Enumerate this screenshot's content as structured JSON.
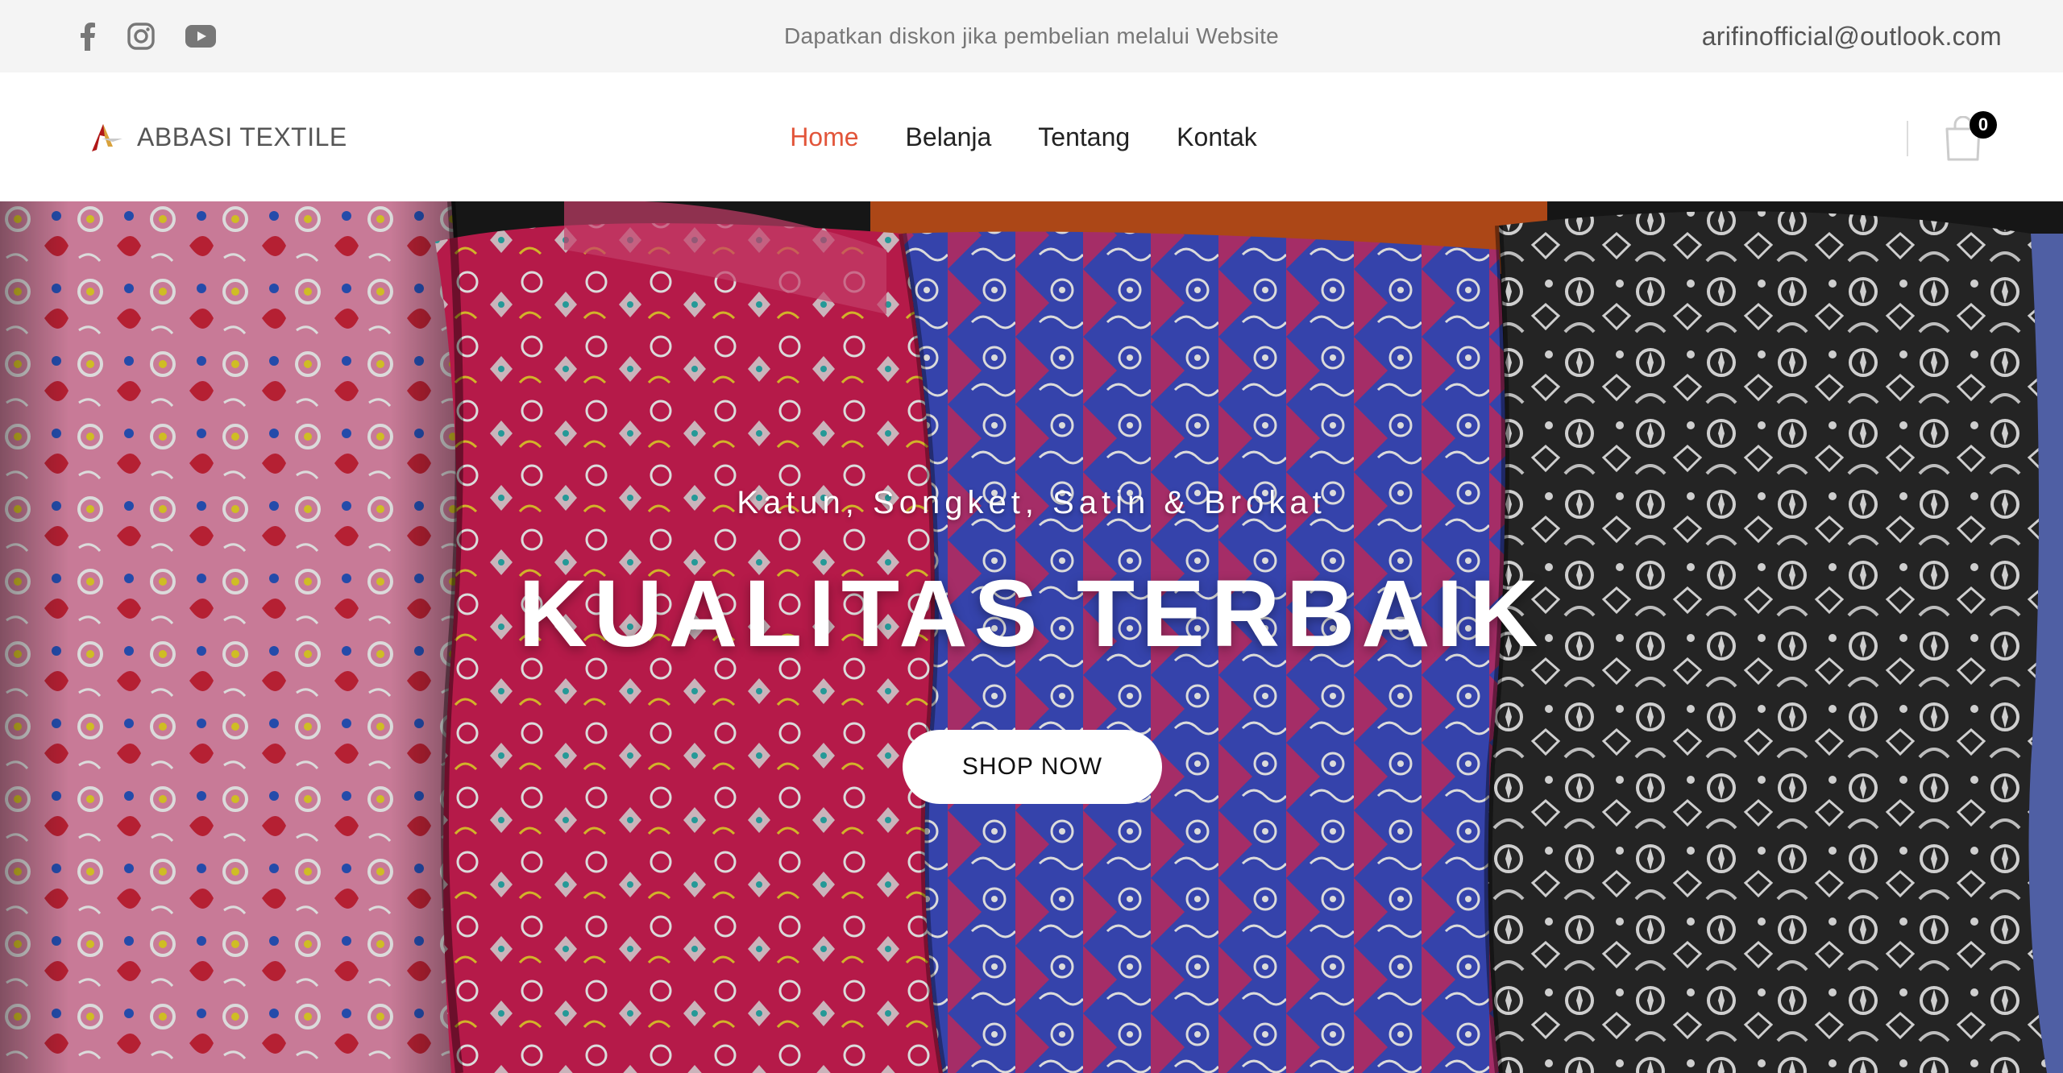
{
  "topbar": {
    "social": [
      {
        "name": "facebook-icon"
      },
      {
        "name": "instagram-icon"
      },
      {
        "name": "youtube-icon"
      }
    ],
    "promo_text": "Dapatkan diskon jika pembelian melalui Website",
    "email": "arifinofficial@outlook.com"
  },
  "header": {
    "brand_name": "ABBASI TEXTILE",
    "nav": [
      {
        "label": "Home",
        "active": true
      },
      {
        "label": "Belanja",
        "active": false
      },
      {
        "label": "Tentang",
        "active": false
      },
      {
        "label": "Kontak",
        "active": false
      }
    ],
    "cart_count": "0"
  },
  "hero": {
    "subtitle": "Katun, Songket, Satin & Brokat",
    "title": "KUALITAS TERBAIK",
    "button_label": "SHOP NOW"
  },
  "colors": {
    "accent": "#e2553a",
    "topbar_bg": "#f4f4f4",
    "text_dark": "#222222",
    "text_muted": "#777777"
  }
}
